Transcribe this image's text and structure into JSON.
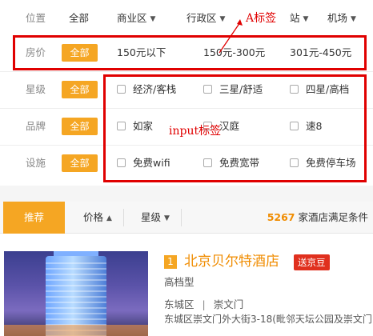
{
  "filters": {
    "location": {
      "label": "位置",
      "all": "全部",
      "dropdowns": [
        "商业区",
        "行政区",
        "站",
        "机场"
      ]
    },
    "price": {
      "label": "房价",
      "all": "全部",
      "options": [
        "150元以下",
        "150元-300元",
        "301元-450元"
      ]
    },
    "star": {
      "label": "星级",
      "all": "全部",
      "options": [
        "经济/客栈",
        "三星/舒适",
        "四星/高档"
      ]
    },
    "brand": {
      "label": "品牌",
      "all": "全部",
      "options": [
        "如家",
        "汉庭",
        "速8"
      ]
    },
    "facility": {
      "label": "设施",
      "all": "全部",
      "options": [
        "免费wifi",
        "免费宽带",
        "免费停车场"
      ]
    }
  },
  "annotations": {
    "a_tag": "A标签",
    "input_tag": "input标签",
    "color": "#e00000"
  },
  "sortbar": {
    "recommend": "推荐",
    "price": "价格",
    "star": "星级",
    "count": "5267",
    "count_suffix": "家酒店满足条件"
  },
  "hotel": {
    "index": "1",
    "name": "北京贝尔特酒店",
    "badge": "送京豆",
    "type": "高档型",
    "district": "东城区",
    "area": "崇文门",
    "address": "东城区崇文门外大街3-18(毗邻天坛公园及崇文门"
  },
  "colors": {
    "accent": "#f5a623",
    "highlight": "#f08c00",
    "badge": "#e0301e"
  }
}
